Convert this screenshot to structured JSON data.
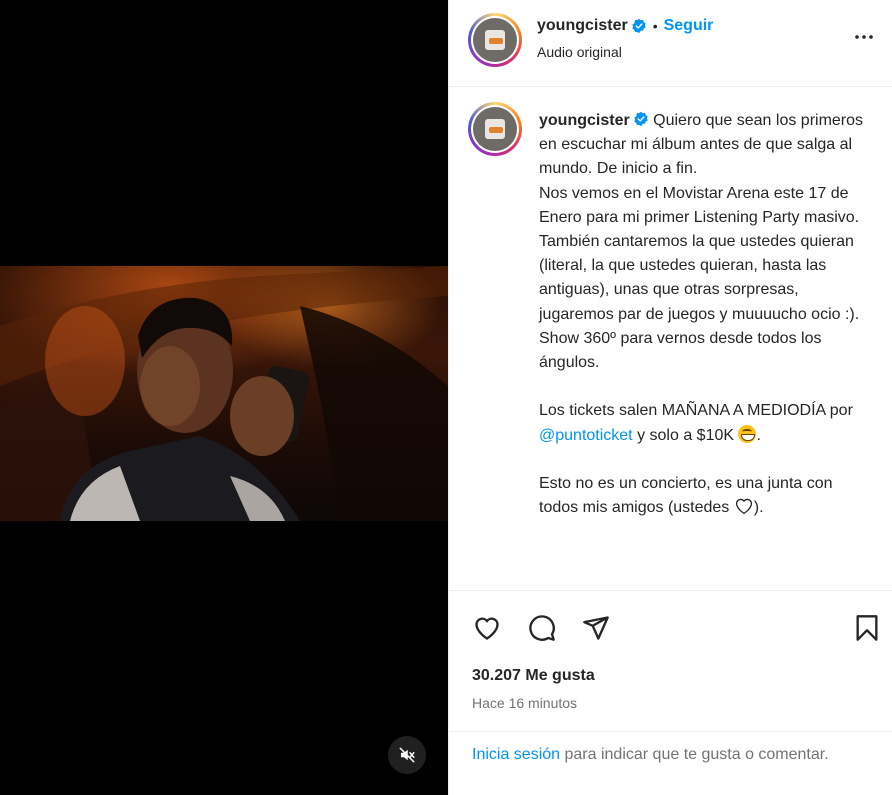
{
  "post": {
    "username": "youngcister",
    "follow_label": "Seguir",
    "separator": "•",
    "audio_label": "Audio original",
    "caption_lines": [
      "Quiero que sean los primeros en escuchar mi álbum antes de que salga al mundo. De inicio a fin.",
      "Nos vemos en el Movistar Arena este 17 de Enero para mi primer Listening Party masivo.",
      "También cantaremos la que ustedes quieran (literal, la que ustedes quieran, hasta las antiguas), unas que otras sorpresas, jugaremos par de juegos y muuuucho ocio :). Show 360º para vernos desde todos los ángulos."
    ],
    "tickets_before": "Los tickets salen MAÑANA A MEDIODÍA por",
    "tickets_mention": "@puntoticket",
    "tickets_after": "y solo a $10K",
    "tickets_end": ".",
    "closing_text": "Esto no es un concierto, es una junta con todos mis amigos (ustedes",
    "closing_end": ").",
    "likes": "30.207 Me gusta",
    "time_ago": "Hace 16 minutos",
    "login_link": "Inicia sesión",
    "login_rest": "para indicar que te gusta o comentar."
  },
  "icons": {
    "verified": "verified-badge-icon",
    "more": "more-options-icon",
    "like": "heart-icon",
    "comment": "comment-icon",
    "share": "share-icon",
    "save": "bookmark-icon",
    "mute": "audio-muted-icon"
  },
  "colors": {
    "accent": "#0095f6",
    "text": "#262626",
    "muted": "#737373",
    "border": "#efefef"
  }
}
